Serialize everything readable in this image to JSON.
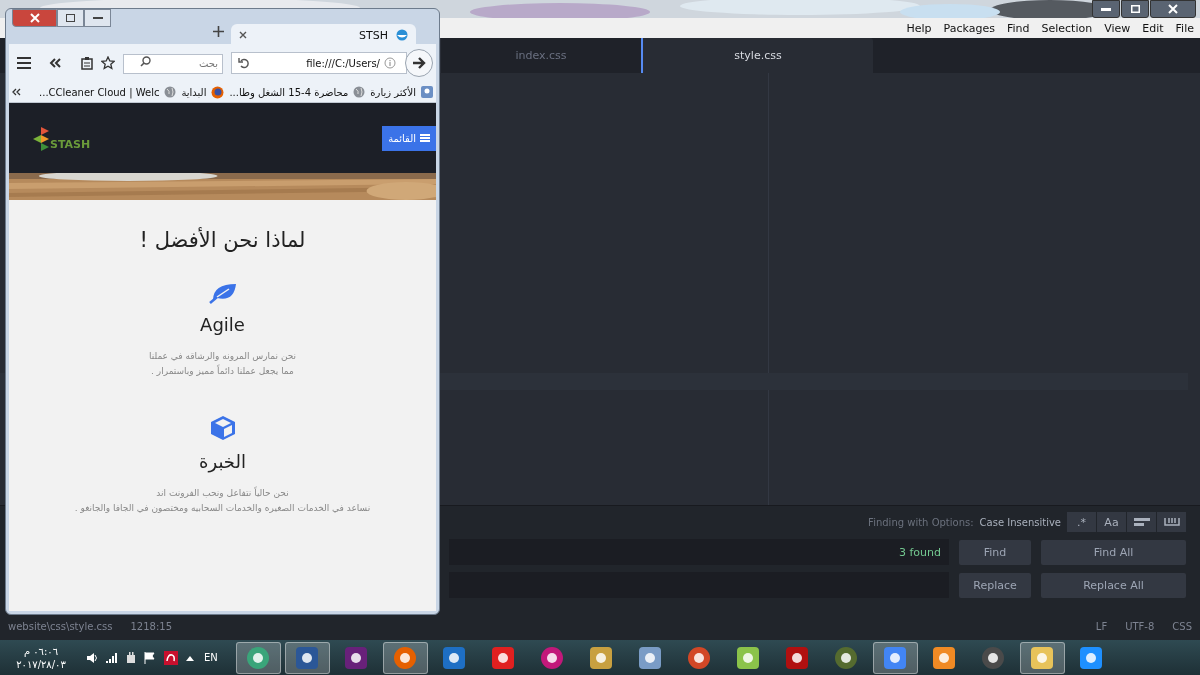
{
  "editor": {
    "menu": [
      "File",
      "Edit",
      "View",
      "Selection",
      "Find",
      "Packages",
      "Help"
    ],
    "tabs": [
      {
        "label": "style.css",
        "selected": true
      },
      {
        "label": "index.css",
        "selected": false
      }
    ],
    "find_panel": {
      "options_label": "Finding with Options:",
      "options_value": "Case Insensitive",
      "toggles": [
        {
          "kind": "whole_word",
          "on": false
        },
        {
          "kind": "selection",
          "on": false
        },
        {
          "kind": "text",
          "label": "Aa",
          "on": false
        },
        {
          "kind": "text",
          "label": ".*",
          "on": false
        }
      ],
      "find_result": "3 found",
      "buttons": [
        "Find All",
        "Find",
        "Replace All",
        "Replace"
      ]
    },
    "status_bar": {
      "path": "website\\css\\style.css",
      "position": "1218:15",
      "items": [
        "CSS",
        "UTF-8",
        "LF"
      ]
    }
  },
  "browser": {
    "tab": {
      "title": "STSH"
    },
    "search": {
      "placeholder": "بحث"
    },
    "url": "file:///C:/Users/",
    "bookmarks": [
      "الأكثر زيارة",
      "محاضرة 4-15 الشغل وطا...",
      "البداية",
      "CCleaner Cloud | Welc..."
    ],
    "page": {
      "logo": "STASH",
      "menu_button": "القائمة",
      "heading": "لماذا نحن الأفضل !",
      "features": [
        {
          "kind": "leaf",
          "title": "Agile",
          "lines": [
            "نحن نمارس المرونه والرشاقه في عملنا",
            "مما يجعل عملنا دائماً مميز وباستمرار ."
          ]
        },
        {
          "kind": "cube",
          "title": "الخبرة",
          "lines": [
            "نحن حالياً نتفاعل ونحب الفرونت اند",
            "نساعد في الخدمات الصغيره والخدمات السحابيه ومختصون في الجافا والجانغو ."
          ]
        }
      ]
    }
  },
  "taskbar": {
    "time": "٠٦:٠٦ م",
    "date": "٢٠١٧/٢٨/٠٣",
    "language": "EN",
    "apps": [
      {
        "active": true
      },
      {
        "active": true
      },
      {
        "active": false
      },
      {
        "active": true
      },
      {
        "active": false
      },
      {
        "active": false
      },
      {
        "active": false
      },
      {
        "active": false
      },
      {
        "active": false
      },
      {
        "active": false
      },
      {
        "active": false
      },
      {
        "active": false
      },
      {
        "active": false
      },
      {
        "active": true
      },
      {
        "active": false
      },
      {
        "active": false
      },
      {
        "active": true
      },
      {
        "active": false
      }
    ]
  }
}
